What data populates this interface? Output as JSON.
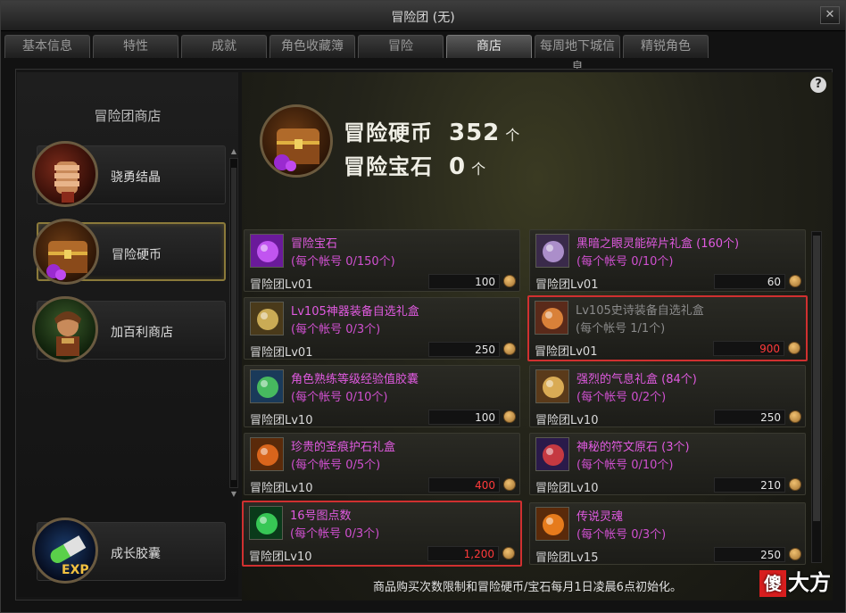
{
  "window": {
    "title": "冒险团 (无)",
    "close_glyph": "✕"
  },
  "tabs": [
    {
      "label": "基本信息",
      "active": false
    },
    {
      "label": "特性",
      "active": false
    },
    {
      "label": "成就",
      "active": false
    },
    {
      "label": "角色收藏簿",
      "active": false
    },
    {
      "label": "冒险",
      "active": false
    },
    {
      "label": "商店",
      "active": true
    },
    {
      "label": "每周地下城信息",
      "active": false
    },
    {
      "label": "精锐角色",
      "active": false
    }
  ],
  "left": {
    "title": "冒险团商店",
    "categories": [
      {
        "label": "骁勇结晶",
        "icon": "fist-icon",
        "selected": false
      },
      {
        "label": "冒险硬币",
        "icon": "treasure-chest-icon",
        "selected": true
      },
      {
        "label": "加百利商店",
        "icon": "merchant-portrait-icon",
        "selected": false
      },
      {
        "label": "成长胶囊",
        "icon": "exp-capsule-icon",
        "selected": false
      }
    ]
  },
  "currency": {
    "coin_label": "冒险硬币",
    "coin_amount": "352",
    "coin_unit": "个",
    "gem_label": "冒险宝石",
    "gem_amount": "0",
    "gem_unit": "个",
    "icon": "treasure-chest-icon"
  },
  "help": {
    "glyph": "?"
  },
  "items": [
    {
      "name": "冒险宝石",
      "limit": "(每个帐号 0/150个)",
      "req": "冒险团Lv01",
      "price": "100",
      "price_red": false,
      "icon": "purple-gem-icon",
      "soldout": false,
      "highlight": false
    },
    {
      "name": "黑暗之眼灵能碎片礼盒 (160个)",
      "limit": "(每个帐号 0/10个)",
      "req": "冒险团Lv01",
      "price": "60",
      "price_red": false,
      "icon": "gift-box-icon",
      "soldout": false,
      "highlight": false
    },
    {
      "name": "Lv105神器装备自选礼盒",
      "limit": "(每个帐号 0/3个)",
      "req": "冒险团Lv01",
      "price": "250",
      "price_red": false,
      "icon": "gold-chest-icon",
      "soldout": false,
      "highlight": false
    },
    {
      "name": "Lv105史诗装备自选礼盒",
      "limit": "(每个帐号 1/1个)",
      "req": "冒险团Lv01",
      "price": "900",
      "price_red": true,
      "icon": "epic-chest-icon",
      "soldout": true,
      "highlight": true
    },
    {
      "name": "角色熟练等级经验值胶囊",
      "limit": "(每个帐号 0/10个)",
      "req": "冒险团Lv10",
      "price": "100",
      "price_red": false,
      "icon": "exp-capsule-icon",
      "soldout": false,
      "highlight": false
    },
    {
      "name": "强烈的气息礼盒 (84个)",
      "limit": "(每个帐号 0/2个)",
      "req": "冒险团Lv10",
      "price": "250",
      "price_red": false,
      "icon": "aura-box-icon",
      "soldout": false,
      "highlight": false
    },
    {
      "name": "珍贵的圣痕护石礼盒",
      "limit": "(每个帐号 0/5个)",
      "req": "冒险团Lv10",
      "price": "400",
      "price_red": true,
      "icon": "stigma-stone-icon",
      "soldout": false,
      "highlight": false
    },
    {
      "name": "神秘的符文原石 (3个)",
      "limit": "(每个帐号 0/10个)",
      "req": "冒险团Lv10",
      "price": "210",
      "price_red": false,
      "icon": "rune-stone-icon",
      "soldout": false,
      "highlight": false
    },
    {
      "name": "16号图点数",
      "limit": "(每个帐号 0/3个)",
      "req": "冒险团Lv10",
      "price": "1,200",
      "price_red": true,
      "icon": "green-potion-icon",
      "soldout": false,
      "highlight": true
    },
    {
      "name": "传说灵魂",
      "limit": "(每个帐号 0/3个)",
      "req": "冒险团Lv15",
      "price": "250",
      "price_red": false,
      "icon": "legendary-soul-icon",
      "soldout": false,
      "highlight": false
    }
  ],
  "footer": {
    "note": "商品购买次数限制和冒险硬币/宝石每月1日凌晨6点初始化。"
  },
  "watermark": {
    "char1": "傻",
    "rest": "大方"
  },
  "scroll": {
    "up_glyph": "▲",
    "down_glyph": "▼"
  }
}
